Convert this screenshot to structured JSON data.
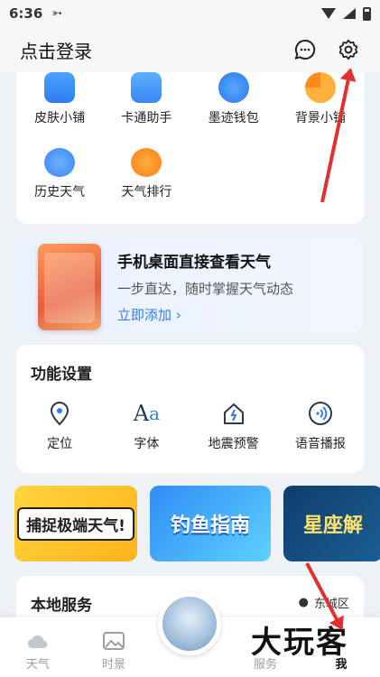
{
  "status": {
    "time": "6:36"
  },
  "header": {
    "login_label": "点击登录"
  },
  "grid": {
    "row1": [
      {
        "label": "皮肤小铺",
        "color": "#3a8cf6"
      },
      {
        "label": "卡通助手",
        "color": "#4b9df8"
      },
      {
        "label": "墨迹钱包",
        "color": "#2d7df0"
      },
      {
        "label": "背景小铺",
        "color": "#ff9a2e"
      }
    ],
    "row2": [
      {
        "label": "历史天气",
        "color": "#4c92f3"
      },
      {
        "label": "天气排行",
        "color": "#ff8d28"
      }
    ]
  },
  "promo": {
    "title": "手机桌面直接查看天气",
    "subtitle": "一步直达，随时掌握天气动态",
    "link": "立即添加"
  },
  "functions": {
    "title": "功能设置",
    "items": [
      {
        "label": "定位"
      },
      {
        "label": "字体"
      },
      {
        "label": "地震预警"
      },
      {
        "label": "语音播报"
      }
    ]
  },
  "banners": [
    {
      "text": "捕捉极端天气!"
    },
    {
      "text": "钓鱼指南"
    },
    {
      "text": "星座解"
    }
  ],
  "local": {
    "title": "本地服务",
    "location": "东城区"
  },
  "nav": {
    "items": [
      {
        "label": "天气"
      },
      {
        "label": "时景"
      },
      {
        "label": "服务"
      },
      {
        "label": "我"
      }
    ]
  },
  "watermark": "大玩客"
}
